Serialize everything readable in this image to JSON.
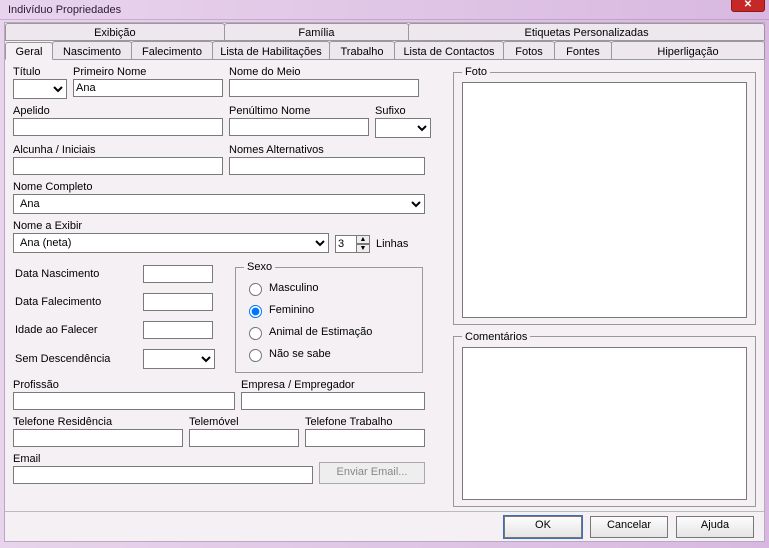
{
  "window": {
    "title": "Indivíduo Propriedades"
  },
  "tabsUpper": {
    "t0": "Exibição",
    "t1": "Família",
    "t2": "Etiquetas Personalizadas"
  },
  "tabsLower": {
    "t0": "Geral",
    "t1": "Nascimento",
    "t2": "Falecimento",
    "t3": "Lista de Habilitações",
    "t4": "Trabalho",
    "t5": "Lista de Contactos",
    "t6": "Fotos",
    "t7": "Fontes",
    "t8": "Hiperligação"
  },
  "labels": {
    "titulo": "Título",
    "primeiroNome": "Primeiro Nome",
    "nomeMeio": "Nome do Meio",
    "apelido": "Apelido",
    "penultimo": "Penúltimo Nome",
    "sufixo": "Sufixo",
    "alcunha": "Alcunha / Iniciais",
    "nomesAlt": "Nomes Alternativos",
    "nomeCompleto": "Nome Completo",
    "nomeExibir": "Nome a Exibir",
    "linhas": "Linhas",
    "dataNasc": "Data Nascimento",
    "dataFalec": "Data Falecimento",
    "idadeFalec": "Idade ao Falecer",
    "semDesc": "Sem Descendência",
    "sexo": "Sexo",
    "masc": "Masculino",
    "fem": "Feminino",
    "animal": "Animal de Estimação",
    "naosabe": "Não se sabe",
    "profissao": "Profissão",
    "empresa": "Empresa / Empregador",
    "telRes": "Telefone Residência",
    "telMov": "Telemóvel",
    "telTrab": "Telefone Trabalho",
    "email": "Email",
    "enviarEmail": "Enviar Email...",
    "foto": "Foto",
    "comentarios": "Comentários"
  },
  "values": {
    "titulo": "",
    "primeiroNome": "Ana",
    "nomeMeio": "",
    "apelido": "",
    "penultimo": "",
    "sufixo": "",
    "alcunha": "",
    "nomesAlt": "",
    "nomeCompleto": "Ana",
    "nomeExibir": "Ana (neta)",
    "linhas": "3",
    "dataNasc": "",
    "dataFalec": "",
    "idadeFalec": "",
    "semDesc": "",
    "sexoSelected": "fem",
    "profissao": "",
    "empresa": "",
    "telRes": "",
    "telMov": "",
    "telTrab": "",
    "email": ""
  },
  "buttons": {
    "ok": "OK",
    "cancel": "Cancelar",
    "help": "Ajuda"
  }
}
